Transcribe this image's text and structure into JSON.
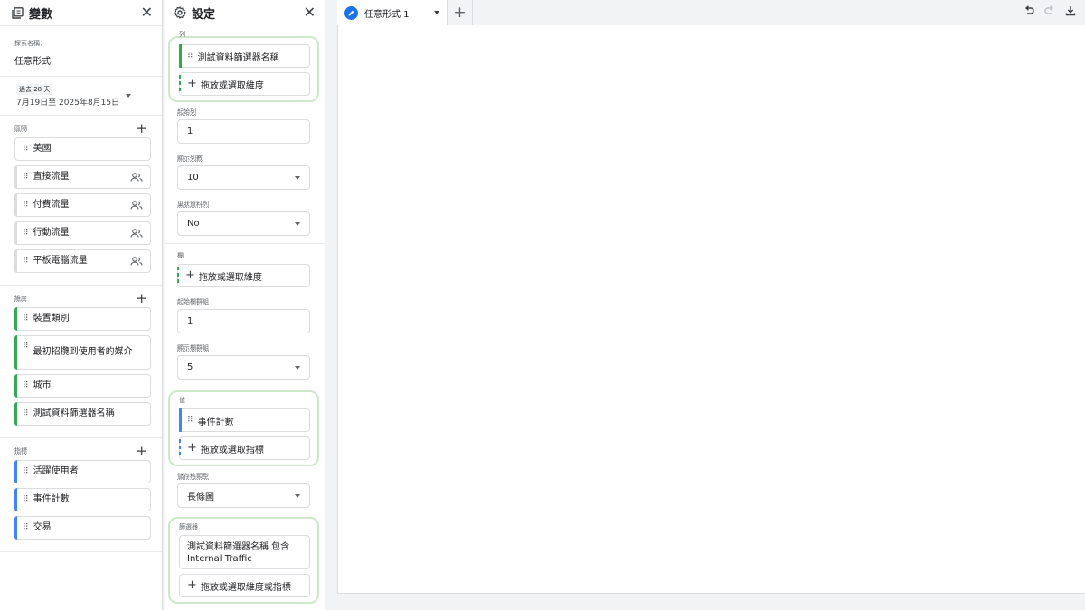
{
  "variables": {
    "title": "變數",
    "explore_name_label": "探索名稱：",
    "explore_name": "任意形式",
    "date_chip": "過去 28 天",
    "date_range": "7月19日至 2025年8月15日",
    "segments_label": "區隔",
    "segments": [
      "美國",
      "直接流量",
      "付費流量",
      "行動流量",
      "平板電腦流量"
    ],
    "dimensions_label": "維度",
    "dimensions": [
      "裝置類別",
      "最初招攬到使用者的媒介",
      "城市",
      "測試資料篩選器名稱"
    ],
    "metrics_label": "指標",
    "metrics": [
      "活躍使用者",
      "事件計數",
      "交易"
    ]
  },
  "settings": {
    "title": "設定",
    "rows_label": "列",
    "rows_chip": "測試資料篩選器名稱",
    "rows_drop": "拖放或選取維度",
    "start_row_label": "起始列",
    "start_row": "1",
    "show_rows_label": "顯示列數",
    "show_rows": "10",
    "nested_label": "巢狀資料列",
    "nested": "No",
    "cols_label": "欄",
    "cols_drop": "拖放或選取維度",
    "start_col_label": "起始欄群組",
    "start_col": "1",
    "show_col_label": "顯示欄群組",
    "show_col": "5",
    "values_label": "值",
    "values_chip": "事件計數",
    "values_drop": "拖放或選取指標",
    "cell_type_label": "儲存格類型",
    "cell_type": "長條圖",
    "filters_label": "篩選器",
    "filter_text": "測試資料篩選器名稱 包含 Internal Traffic",
    "filters_drop": "拖放或選取維度或指標"
  },
  "canvas": {
    "tab_label": "任意形式 1"
  },
  "colors": {
    "dimension": "#34a853",
    "metric": "#4285f4",
    "accent": "#1a73e8"
  }
}
